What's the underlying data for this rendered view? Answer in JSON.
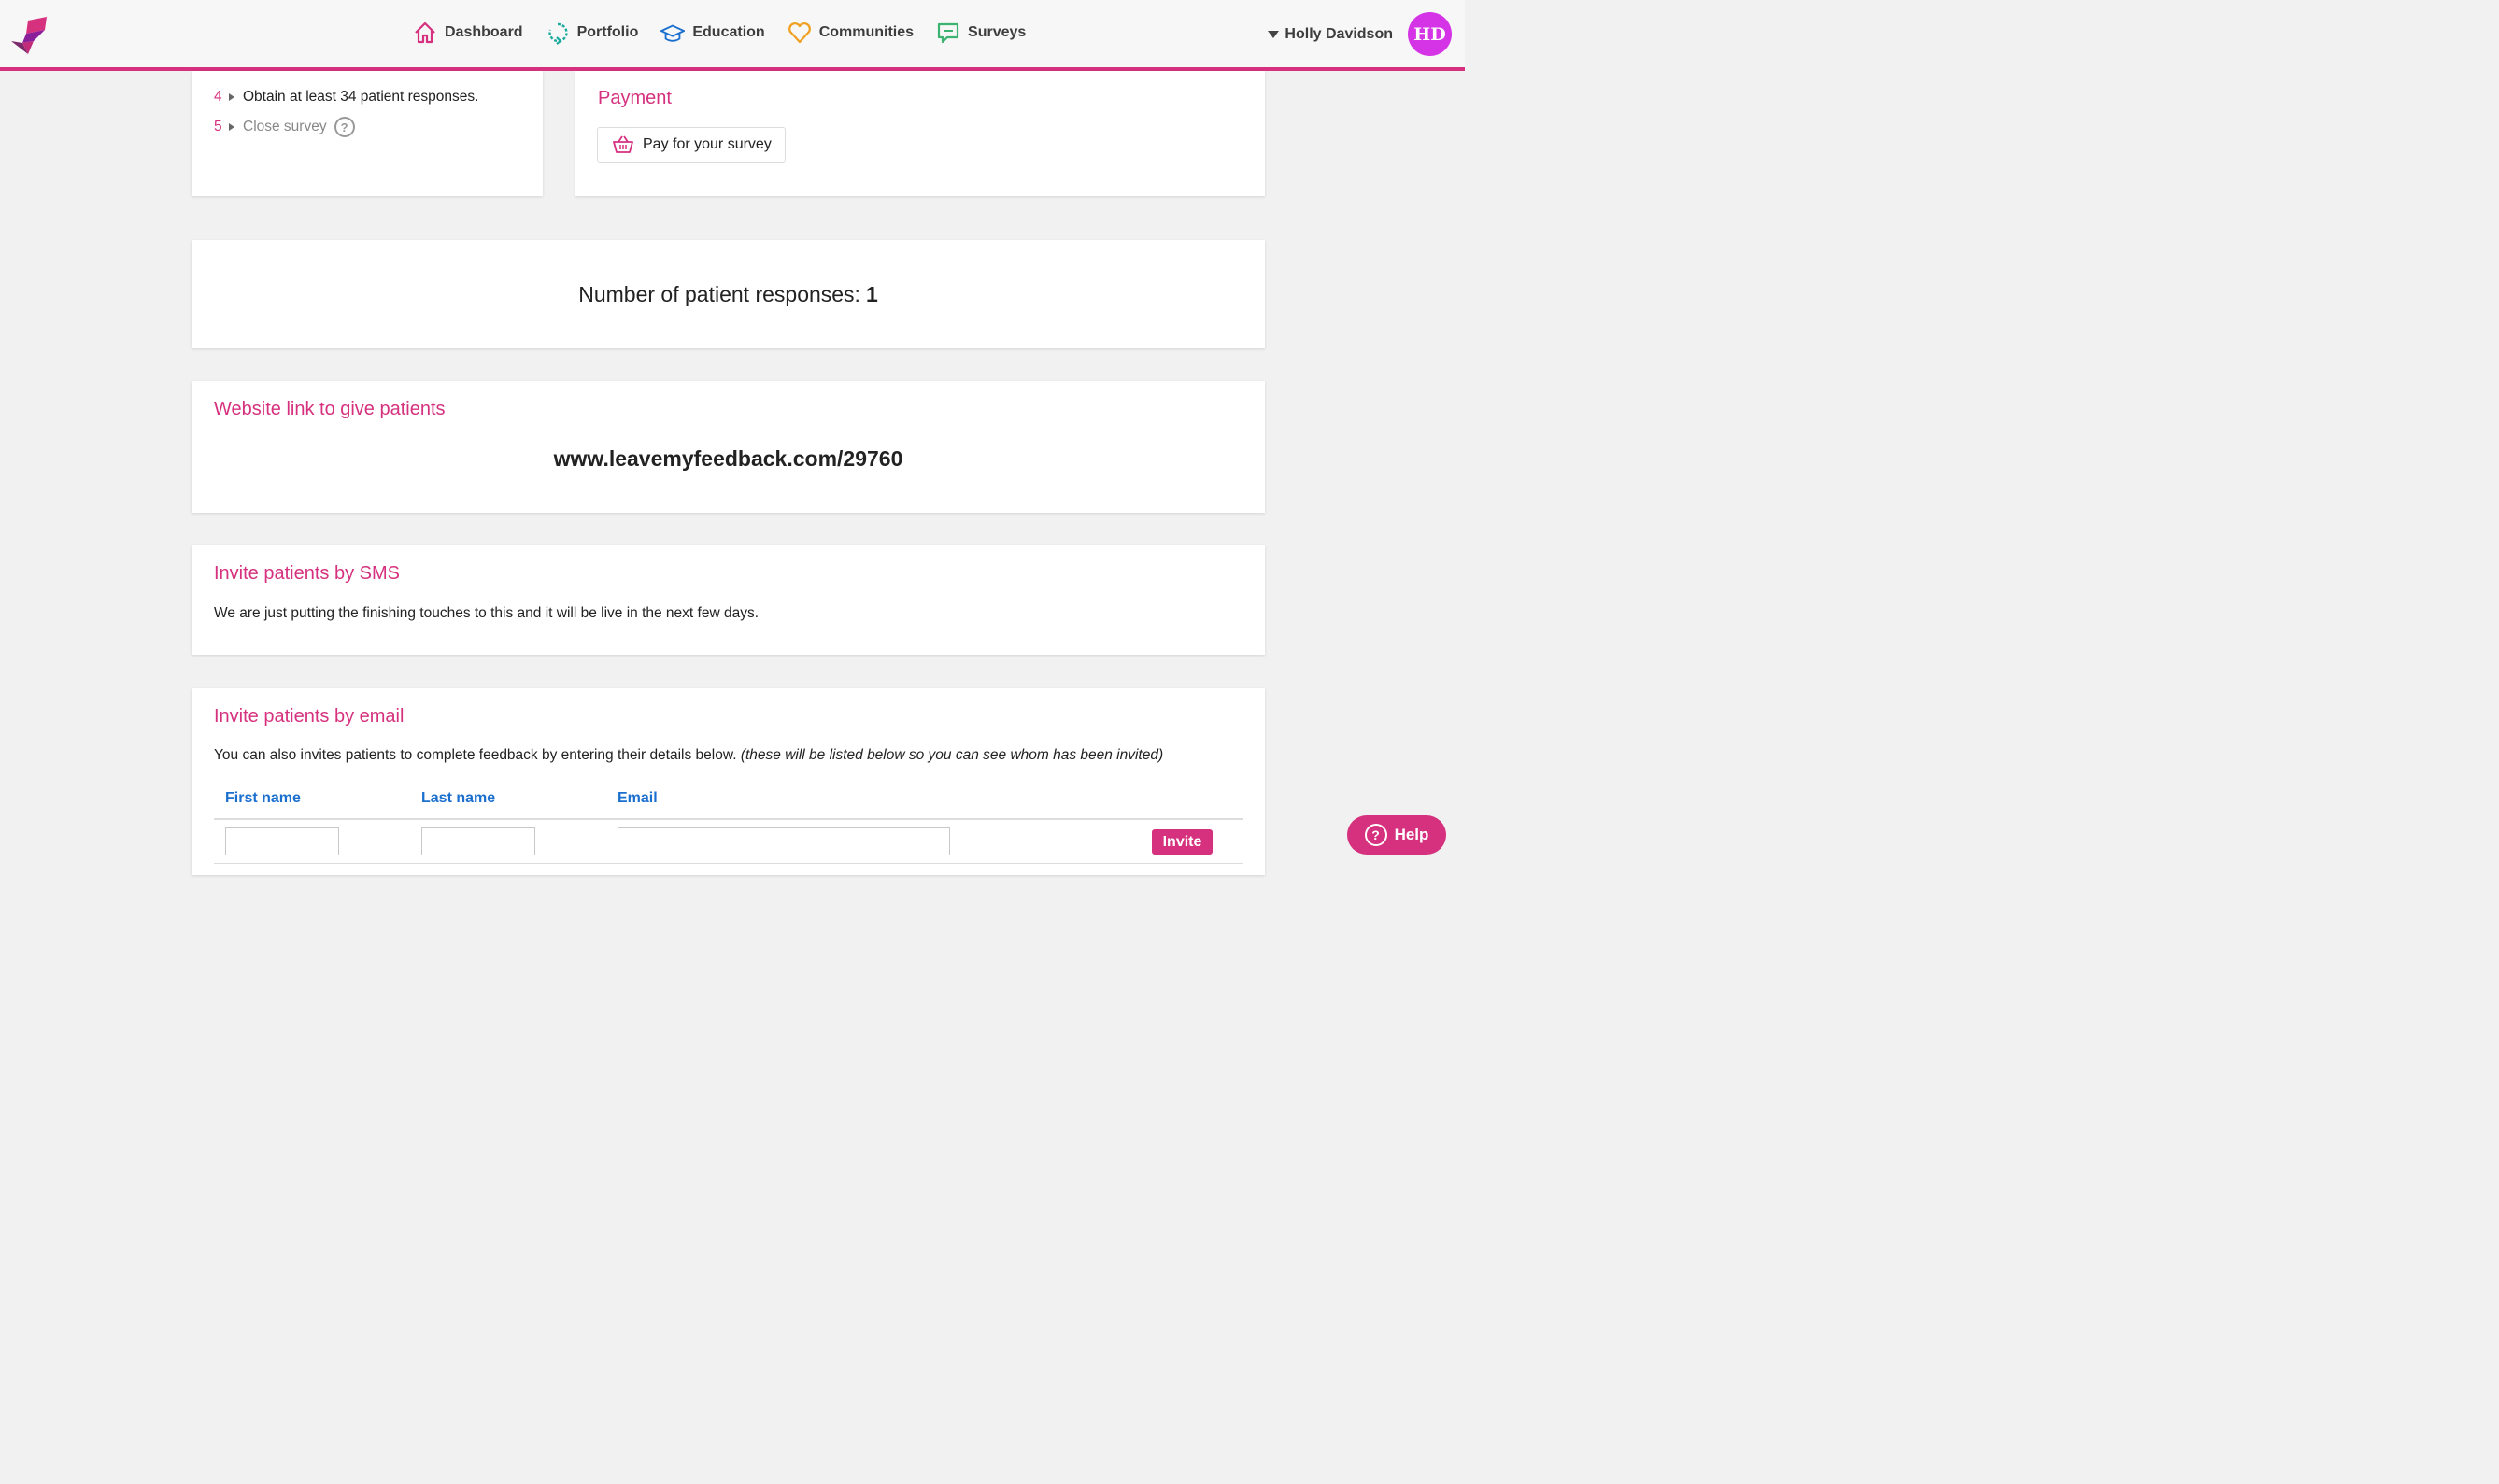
{
  "nav": {
    "items": [
      {
        "label": "Dashboard",
        "icon": "home-icon",
        "color": "#d6317e"
      },
      {
        "label": "Portfolio",
        "icon": "refresh-icon",
        "color": "#1aaa9e"
      },
      {
        "label": "Education",
        "icon": "graduation-cap-icon",
        "color": "#1a6fcf"
      },
      {
        "label": "Communities",
        "icon": "heart-icon",
        "color": "#f0a020"
      },
      {
        "label": "Surveys",
        "icon": "chat-icon",
        "color": "#3cb371"
      }
    ]
  },
  "user": {
    "name": "Holly Davidson",
    "initials": "HD",
    "avatar_color": "#d533e6"
  },
  "steps": [
    {
      "num": "4",
      "text": "Obtain at least 34 patient responses."
    },
    {
      "num": "5",
      "text": "Close survey",
      "muted": true
    }
  ],
  "help_mark": "?",
  "payment": {
    "title": "Payment",
    "button": "Pay for your survey"
  },
  "responses": {
    "label": "Number of patient responses:",
    "count": "1"
  },
  "link": {
    "title": "Website link to give patients",
    "url": "www.leavemyfeedback.com/29760"
  },
  "sms": {
    "title": "Invite patients by SMS",
    "text": "We are just putting the finishing touches to this and it will be live in the next few days."
  },
  "email": {
    "title": "Invite patients by email",
    "text": "You can also invites patients to complete feedback by entering their details below.",
    "note": "(these will be listed below so you can see whom has been invited)",
    "columns": [
      "First name",
      "Last name",
      "Email"
    ],
    "first_name_value": "",
    "last_name_value": "",
    "email_value": "",
    "invite_button": "Invite"
  },
  "help_button": "Help",
  "accent_color": "#d6317e"
}
